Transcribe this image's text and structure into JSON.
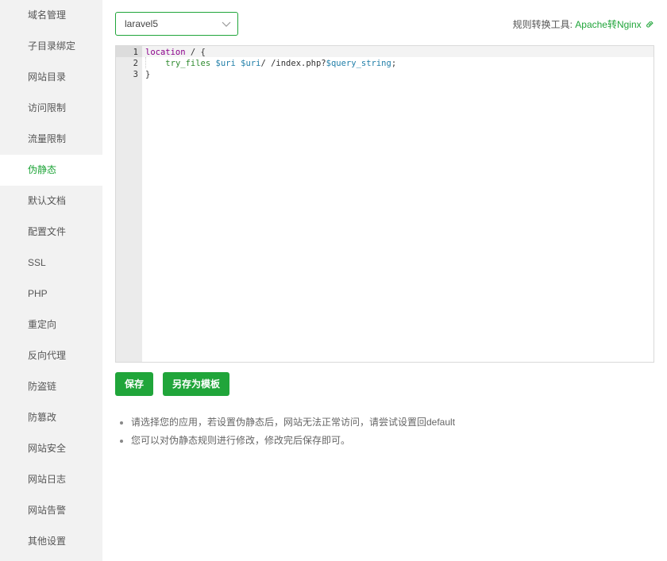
{
  "sidebar": {
    "items": [
      {
        "label": "域名管理"
      },
      {
        "label": "子目录绑定"
      },
      {
        "label": "网站目录"
      },
      {
        "label": "访问限制"
      },
      {
        "label": "流量限制"
      },
      {
        "label": "伪静态",
        "active": true
      },
      {
        "label": "默认文档"
      },
      {
        "label": "配置文件"
      },
      {
        "label": "SSL"
      },
      {
        "label": "PHP"
      },
      {
        "label": "重定向"
      },
      {
        "label": "反向代理"
      },
      {
        "label": "防盗链"
      },
      {
        "label": "防篡改"
      },
      {
        "label": "网站安全"
      },
      {
        "label": "网站日志"
      },
      {
        "label": "网站告警"
      },
      {
        "label": "其他设置"
      }
    ]
  },
  "rewrite": {
    "selected_template": "laravel5",
    "tool_label": "规则转换工具:",
    "tool_link": "Apache转Nginx",
    "link_icon": "link-icon",
    "code_lines": [
      {
        "number": "1",
        "parts": [
          {
            "t": "location",
            "c": "kw"
          },
          {
            "t": " / {",
            "c": ""
          }
        ]
      },
      {
        "number": "2",
        "parts": [
          {
            "t": "    ",
            "c": ""
          },
          {
            "t": "try_files",
            "c": "fn"
          },
          {
            "t": " ",
            "c": ""
          },
          {
            "t": "$uri",
            "c": "var"
          },
          {
            "t": " ",
            "c": ""
          },
          {
            "t": "$uri",
            "c": "var"
          },
          {
            "t": "/ /index.php?",
            "c": ""
          },
          {
            "t": "$query_string",
            "c": "var"
          },
          {
            "t": ";",
            "c": ""
          }
        ]
      },
      {
        "number": "3",
        "parts": [
          {
            "t": "}",
            "c": ""
          }
        ]
      }
    ],
    "save_label": "保存",
    "save_as_template_label": "另存为模板",
    "tips": [
      "请选择您的应用，若设置伪静态后，网站无法正常访问，请尝试设置回default",
      "您可以对伪静态规则进行修改，修改完后保存即可。"
    ]
  },
  "colors": {
    "accent": "#20a53a",
    "sidebar_bg": "#f2f2f2",
    "keyword": "#8b008b",
    "function": "#2f8a2f",
    "variable": "#1f7ea8"
  }
}
